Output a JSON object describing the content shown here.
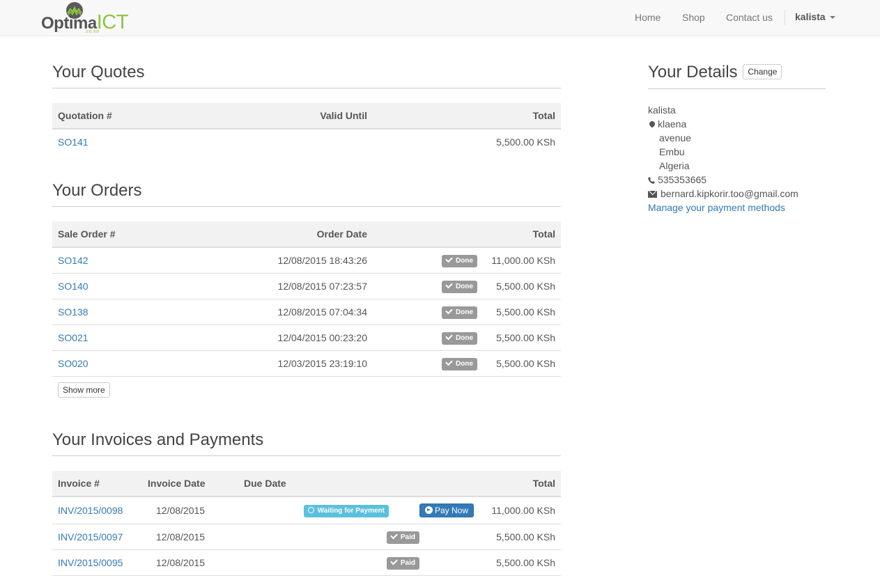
{
  "brand": {
    "name_part1": "Optima",
    "name_part2": "ICT",
    "sub": ".co.ke"
  },
  "nav": {
    "home": "Home",
    "shop": "Shop",
    "contact": "Contact us",
    "user": "kalista"
  },
  "quotes": {
    "title": "Your Quotes",
    "headers": [
      "Quotation #",
      "Valid Until",
      "Total"
    ],
    "rows": [
      {
        "number": "SO141",
        "valid_until": "",
        "total": "5,500.00 KSh"
      }
    ]
  },
  "orders": {
    "title": "Your Orders",
    "headers": [
      "Sale Order #",
      "Order Date",
      "Total"
    ],
    "rows": [
      {
        "number": "SO142",
        "date": "12/08/2015 18:43:26",
        "status": "Done",
        "total": "11,000.00 KSh"
      },
      {
        "number": "SO140",
        "date": "12/08/2015 07:23:57",
        "status": "Done",
        "total": "5,500.00 KSh"
      },
      {
        "number": "SO138",
        "date": "12/08/2015 07:04:34",
        "status": "Done",
        "total": "5,500.00 KSh"
      },
      {
        "number": "SO021",
        "date": "12/04/2015 00:23:20",
        "status": "Done",
        "total": "5,500.00 KSh"
      },
      {
        "number": "SO020",
        "date": "12/03/2015 23:19:10",
        "status": "Done",
        "total": "5,500.00 KSh"
      }
    ],
    "show_more": "Show more"
  },
  "invoices": {
    "title": "Your Invoices and Payments",
    "headers": [
      "Invoice #",
      "Invoice Date",
      "Due Date",
      "Total"
    ],
    "rows": [
      {
        "number": "INV/2015/0098",
        "date": "12/08/2015",
        "status": "Waiting for Payment",
        "action": "Pay Now",
        "total": "11,000.00 KSh"
      },
      {
        "number": "INV/2015/0097",
        "date": "12/08/2015",
        "status": "Paid",
        "total": "5,500.00 KSh"
      },
      {
        "number": "INV/2015/0095",
        "date": "12/08/2015",
        "status": "Paid",
        "total": "5,500.00 KSh"
      }
    ]
  },
  "details": {
    "title": "Your Details",
    "change": "Change",
    "name": "kalista",
    "address_line1": "klaena",
    "address_line2": "avenue",
    "city": "Embu",
    "country": "Algeria",
    "phone": "535353665",
    "email": "bernard.kipkorir.too@gmail.com",
    "manage_link": "Manage your payment methods"
  },
  "colors": {
    "link": "#337ab7",
    "brand_green": "#8dc63f",
    "label_default": "#999999",
    "label_info": "#5bc0de",
    "primary": "#337ab7"
  }
}
